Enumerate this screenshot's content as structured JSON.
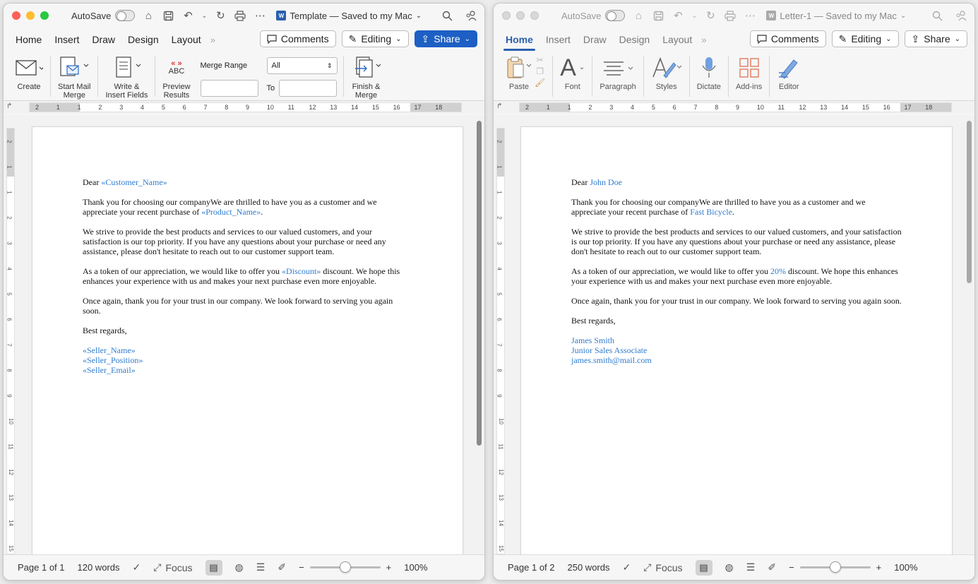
{
  "left_window": {
    "autosave_label": "AutoSave",
    "title": "Template — Saved to my Mac",
    "tabs": [
      "Home",
      "Insert",
      "Draw",
      "Design",
      "Layout"
    ],
    "comments_label": "Comments",
    "editing_label": "Editing",
    "share_label": "Share",
    "ribbon": {
      "create": "Create",
      "start_mail_merge": [
        "Start Mail",
        "Merge"
      ],
      "write_insert_fields": [
        "Write &",
        "Insert Fields"
      ],
      "preview_results": [
        "Preview",
        "Results"
      ],
      "abc": "ABC",
      "merge_range_label": "Merge Range",
      "merge_range_value": "All",
      "to_label": "To",
      "finish_merge": [
        "Finish &",
        "Merge"
      ]
    },
    "ruler_numbers": [
      "2",
      "1",
      "1",
      "2",
      "3",
      "4",
      "5",
      "6",
      "7",
      "8",
      "9",
      "10",
      "11",
      "12",
      "13",
      "14",
      "15",
      "16",
      "17",
      "18"
    ],
    "vruler_numbers": [
      "2",
      "1",
      "1",
      "2",
      "3",
      "4",
      "5",
      "6",
      "7",
      "8",
      "9",
      "10",
      "11",
      "12",
      "13",
      "14",
      "15",
      "16",
      "17",
      "18",
      "19"
    ],
    "letter": {
      "dear": "Dear ",
      "customer": "«Customer_Name»",
      "p1a": "Thank you for choosing our companyWe are thrilled to have you as a customer and we appreciate your recent purchase of ",
      "product": "«Product_Name»",
      "p1b": ".",
      "p2": "We strive to provide the best products and services to our valued customers, and your satisfaction is our top priority. If you have any questions about your purchase or need any assistance, please don't hesitate to reach out to our customer support team.",
      "p3a": "As a token of our appreciation, we would like to offer you ",
      "discount": "«Discount»",
      "p3b": " discount. We hope this enhances your experience with us and makes your next purchase even more enjoyable.",
      "p4": "Once again, thank you for your trust in our company. We look forward to serving you again soon.",
      "regards": "Best regards,",
      "seller_name": "«Seller_Name»",
      "seller_position": "«Seller_Position»",
      "seller_email": "«Seller_Email»"
    },
    "status": {
      "page": "Page 1 of 1",
      "words": "120 words",
      "focus": "Focus",
      "zoom": "100%"
    }
  },
  "right_window": {
    "autosave_label": "AutoSave",
    "title": "Letter-1 — Saved to my Mac",
    "tabs": [
      "Home",
      "Insert",
      "Draw",
      "Design",
      "Layout"
    ],
    "comments_label": "Comments",
    "editing_label": "Editing",
    "share_label": "Share",
    "ribbon": {
      "paste": "Paste",
      "font": "Font",
      "paragraph": "Paragraph",
      "styles": "Styles",
      "dictate": "Dictate",
      "addins": "Add-ins",
      "editor": "Editor"
    },
    "ruler_numbers": [
      "2",
      "1",
      "1",
      "2",
      "3",
      "4",
      "5",
      "6",
      "7",
      "8",
      "9",
      "10",
      "11",
      "12",
      "13",
      "14",
      "15",
      "16",
      "17",
      "18"
    ],
    "vruler_numbers": [
      "2",
      "1",
      "1",
      "2",
      "3",
      "4",
      "5",
      "6",
      "7",
      "8",
      "9",
      "10",
      "11",
      "12",
      "13",
      "14",
      "15",
      "16",
      "17",
      "18",
      "19"
    ],
    "letter": {
      "dear": "Dear ",
      "customer": "John Doe",
      "p1a": "Thank you for choosing our companyWe are thrilled to have you as a customer and we appreciate your recent purchase of ",
      "product": "Fast Bicycle",
      "p1b": ".",
      "p2": "We strive to provide the best products and services to our valued customers, and your satisfaction is our top priority. If you have any questions about your purchase or need any assistance, please don't hesitate to reach out to our customer support team.",
      "p3a": "As a token of our appreciation, we would like to offer you ",
      "discount": "20%",
      "p3b": " discount. We hope this enhances your experience with us and makes your next purchase even more enjoyable.",
      "p4": "Once again, thank you for your trust in our company. We look forward to serving you again soon.",
      "regards": "Best regards,",
      "seller_name": "James Smith",
      "seller_position": "Junior Sales Associate",
      "seller_email": "james.smith@mail.com"
    },
    "status": {
      "page": "Page 1 of 2",
      "words": "250 words",
      "focus": "Focus",
      "zoom": "100%"
    }
  },
  "colors": {
    "accent": "#2b5fad",
    "share_blue": "#1d5fc4",
    "merge_field": "#2e7bcf",
    "close": "#fe5f57",
    "minimize": "#febc2e",
    "maximize": "#28c840"
  }
}
